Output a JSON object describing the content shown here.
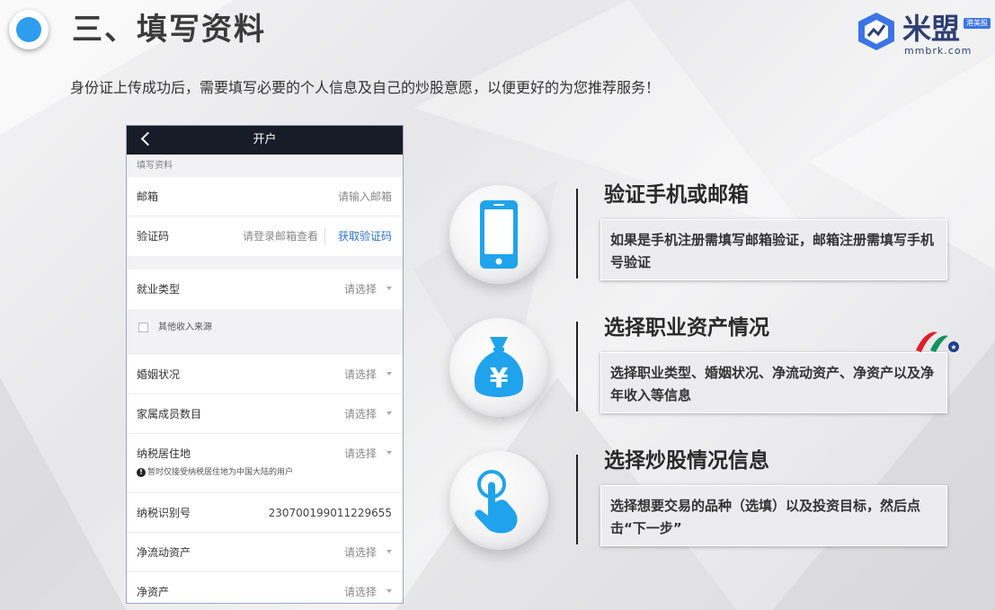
{
  "header": {
    "title": "三、填写资料",
    "subtitle": "身份证上传成功后，需要填写必要的个人信息及自己的炒股意愿，以便更好的为您推荐服务！"
  },
  "logo": {
    "name": "米盟",
    "badge": "港美股",
    "domain": "mmbrk.com",
    "color": "#2e3f73",
    "accent": "#3b74e6"
  },
  "phone": {
    "title": "开户",
    "back_icon": "chevron-left-icon",
    "section": "填写资料",
    "email": {
      "label": "邮箱",
      "placeholder": "请输入邮箱"
    },
    "code": {
      "label": "验证码",
      "placeholder": "请登录邮箱查看",
      "button": "获取验证码"
    },
    "employment": {
      "label": "就业类型",
      "value": "请选择"
    },
    "other_income": {
      "label": "其他收入来源"
    },
    "marital": {
      "label": "婚姻状况",
      "value": "请选择"
    },
    "family": {
      "label": "家属成员数目",
      "value": "请选择"
    },
    "tax_residence": {
      "label": "纳税居住地",
      "value": "请选择",
      "note": "暂时仅接受纳税居住地为中国大陆的用户"
    },
    "tax_id": {
      "label": "纳税识别号",
      "value": "230700199011229655"
    },
    "liquid_assets": {
      "label": "净流动资产",
      "value": "请选择"
    },
    "net_assets": {
      "label": "净资产",
      "value": "请选择"
    }
  },
  "features": [
    {
      "icon": "smartphone-icon",
      "title": "验证手机或邮箱",
      "desc": "如果是手机注册需填写邮箱验证，邮箱注册需填写手机号验证"
    },
    {
      "icon": "money-bag-yuan-icon",
      "title": "选择职业资产情况",
      "desc": "选择职业类型、婚姻状况、净流动资产、净资产以及净年收入等信息"
    },
    {
      "icon": "tap-hand-icon",
      "title": "选择炒股情况信息",
      "desc": "选择想要交易的品种（选填）以及投资目标，然后点击“下一步”"
    }
  ],
  "colors": {
    "icon_blue": "#1fa3ec",
    "header_dark": "#181c28",
    "link_blue": "#2f71c9"
  }
}
